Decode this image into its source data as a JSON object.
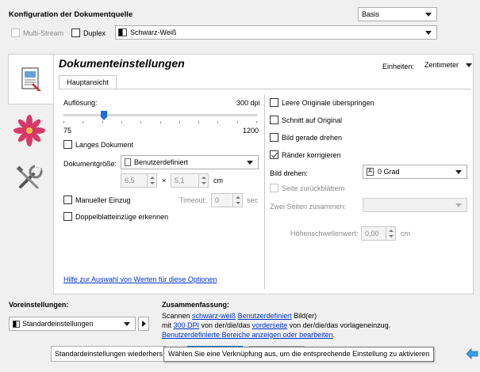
{
  "source": {
    "title": "Konfiguration der Dokumentquelle",
    "mode_value": "Basis",
    "multistream_label": "Multi-Stream",
    "duplex_label": "Duplex",
    "color_value": "Schwarz-Weiß"
  },
  "doc": {
    "title": "Dokumenteinstellungen",
    "units_label": "Einheiten:",
    "units_value": "Zentimeter",
    "tab_label": "Hauptansicht"
  },
  "left": {
    "resolution_label": "Auflösung:",
    "resolution_value": "300 dpi",
    "slider_min": "75",
    "slider_max": "1200",
    "slider_fraction": 0.2,
    "long_doc_label": "Langes Dokument",
    "size_label": "Dokumentgröße:",
    "size_value": "Benutzerdefiniert",
    "width_value": "6,5",
    "times": "×",
    "height_value": "5,1",
    "unit": "cm",
    "manual_feed_label": "Manueller Einzug",
    "timeout_label": "Timeout:",
    "timeout_value": "0",
    "timeout_unit": "sec",
    "double_feed_label": "Doppelblatteinzüge erkennen",
    "help_link": "Hilfe zur Auswahl von Werten für diese Optionen"
  },
  "right": {
    "skip_blank_label": "Leere Originale überspringen",
    "crop_label": "Schnitt auf Original",
    "straighten_label": "Bild gerade drehen",
    "edges_label": "Ränder korrigieren",
    "rotate_label": "Bild drehen:",
    "rotate_value": "0 Grad",
    "page_flip_label": "Seite zurückblättern",
    "merge_label": "Zwei Seiten zusammen:",
    "threshold_label": "Höhenschwellenwert:",
    "threshold_value": "0,00",
    "threshold_unit": "cm"
  },
  "presets": {
    "title": "Voreinstellungen:",
    "value": "Standardeinstellungen",
    "restore_button": "Standardeinstellungen wiederhers"
  },
  "summary": {
    "title": "Zusammenfassung:",
    "l1_a": "Scannen ",
    "l1_link1": "schwarz-weiß",
    "l1_sp": " ",
    "l1_link2": "Benutzerdefiniert",
    "l1_b": " Bild(er)",
    "l2_a": " mit ",
    "l2_link1": "300 DPI",
    "l2_b": "  von der/die/das ",
    "l2_link2": "vorderseite",
    "l2_c": " von der/die/das vorlageneinzug.",
    "l3_link": "Benutzerdefinierte Bereiche anzeigen oder bearbeiten",
    "l3_b": "."
  },
  "tooltip": {
    "text": "Wählen Sie eine Verknüpfung aus, um die entsprechende Einstellung zu aktivieren"
  },
  "colors": {
    "accent": "#1e6fd9",
    "link": "#0033cc"
  }
}
